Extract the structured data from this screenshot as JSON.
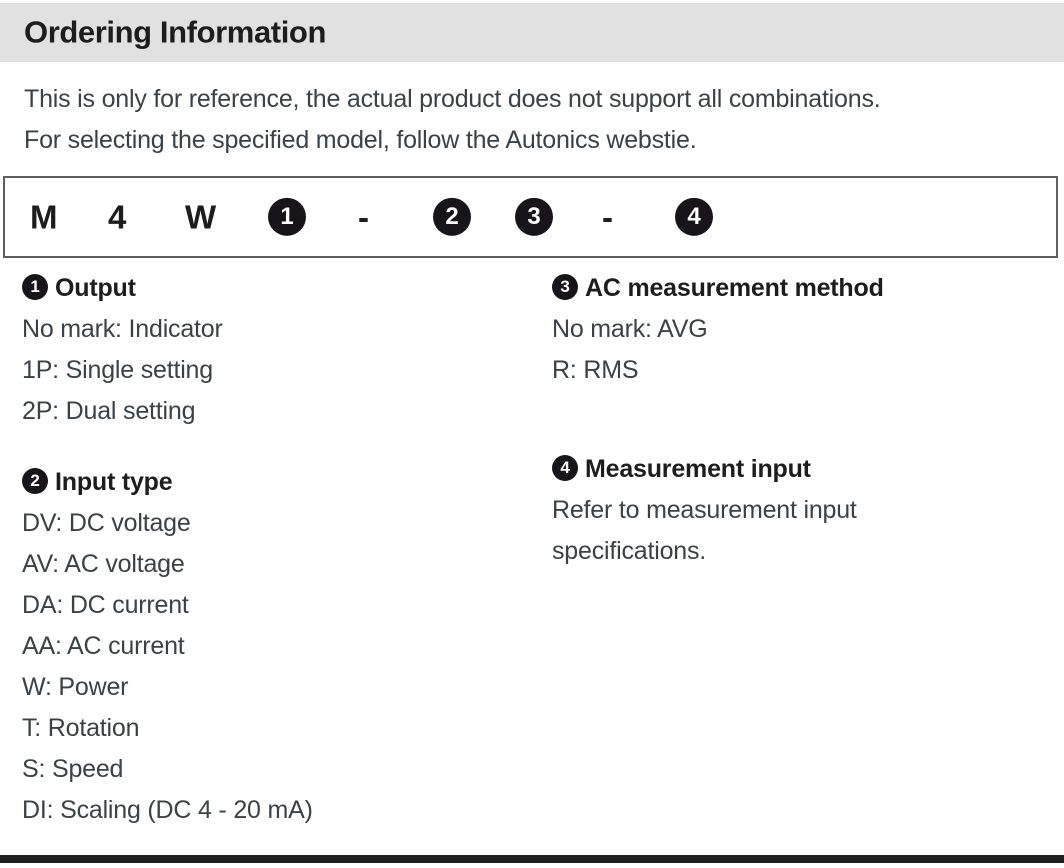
{
  "section": {
    "title": "Ordering Information"
  },
  "intro": {
    "lines": [
      "This is only for reference, the actual product does not support all combinations.",
      "For selecting the specified model, follow the Autonics webstie."
    ]
  },
  "model_code": {
    "cells": [
      {
        "type": "text",
        "value": "M"
      },
      {
        "type": "text",
        "value": "4"
      },
      {
        "type": "text",
        "value": "W"
      },
      {
        "type": "badge",
        "value": "1"
      },
      {
        "type": "dash",
        "value": "-"
      },
      {
        "type": "badge",
        "value": "2"
      },
      {
        "type": "badge",
        "value": "3"
      },
      {
        "type": "dash",
        "value": "-"
      },
      {
        "type": "badge",
        "value": "4"
      }
    ]
  },
  "legend": {
    "left": [
      {
        "badge": "1",
        "title": "Output",
        "items": [
          "No mark: Indicator",
          "1P: Single setting",
          "2P: Dual setting"
        ]
      },
      {
        "badge": "2",
        "title": "Input type",
        "items": [
          "DV: DC voltage",
          "AV: AC voltage",
          "DA: DC current",
          "AA: AC current",
          "W: Power",
          "T: Rotation",
          "S: Speed",
          "DI: Scaling (DC 4 - 20 mA)"
        ]
      }
    ],
    "right": [
      {
        "badge": "3",
        "title": "AC measurement method",
        "items": [
          "No mark: AVG",
          "R: RMS"
        ]
      },
      {
        "badge": "4",
        "title": "Measurement input",
        "items": [
          "Refer to measurement input",
          "specifications."
        ]
      }
    ]
  },
  "colors": {
    "header_bg": "#e1e1e1",
    "badge_bg": "#17151a",
    "body_text": "#3a4147",
    "heading_text": "#1d1d1d",
    "box_border": "#5e5e5e",
    "bottom_bar": "#1e1e1e"
  }
}
